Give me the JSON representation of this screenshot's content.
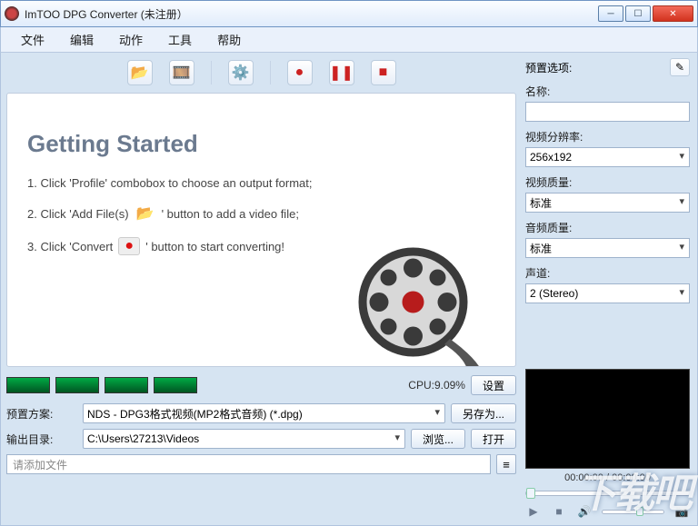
{
  "titlebar": {
    "title": "ImTOO DPG Converter (未注册）"
  },
  "menubar": {
    "items": [
      "文件",
      "编辑",
      "动作",
      "工具",
      "帮助"
    ]
  },
  "toolbar": {
    "icons": [
      "open-folder-icon",
      "add-file-icon",
      "settings-gear-icon",
      "record-icon",
      "pause-icon",
      "stop-icon"
    ]
  },
  "getting_started": {
    "heading": "Getting Started",
    "line1a": "1. Click 'Profile' combobox to choose an output format;",
    "line2a": "2. Click 'Add File(s)",
    "line2b": "' button to add a video file;",
    "line3a": "3. Click 'Convert",
    "line3b": "' button to start converting!"
  },
  "cpu": {
    "label": "CPU:9.09%",
    "settings_btn": "设置"
  },
  "profile": {
    "label": "预置方案:",
    "value": "NDS - DPG3格式视频(MP2格式音频) (*.dpg)",
    "save_as_btn": "另存为..."
  },
  "output": {
    "label": "输出目录:",
    "value": "C:\\Users\\27213\\Videos",
    "browse_btn": "浏览...",
    "open_btn": "打开"
  },
  "addfile": {
    "placeholder": "请添加文件"
  },
  "right": {
    "preset_label": "预置选项:",
    "fields": {
      "name": {
        "label": "名称:",
        "value": ""
      },
      "resolution": {
        "label": "视频分辨率:",
        "value": "256x192"
      },
      "video_quality": {
        "label": "视频质量:",
        "value": "标准"
      },
      "audio_quality": {
        "label": "音频质量:",
        "value": "标准"
      },
      "channel": {
        "label": "声道:",
        "value": "2 (Stereo)"
      }
    }
  },
  "player": {
    "time": "00:00:00 / 00:00:00"
  },
  "watermark": "下载吧"
}
